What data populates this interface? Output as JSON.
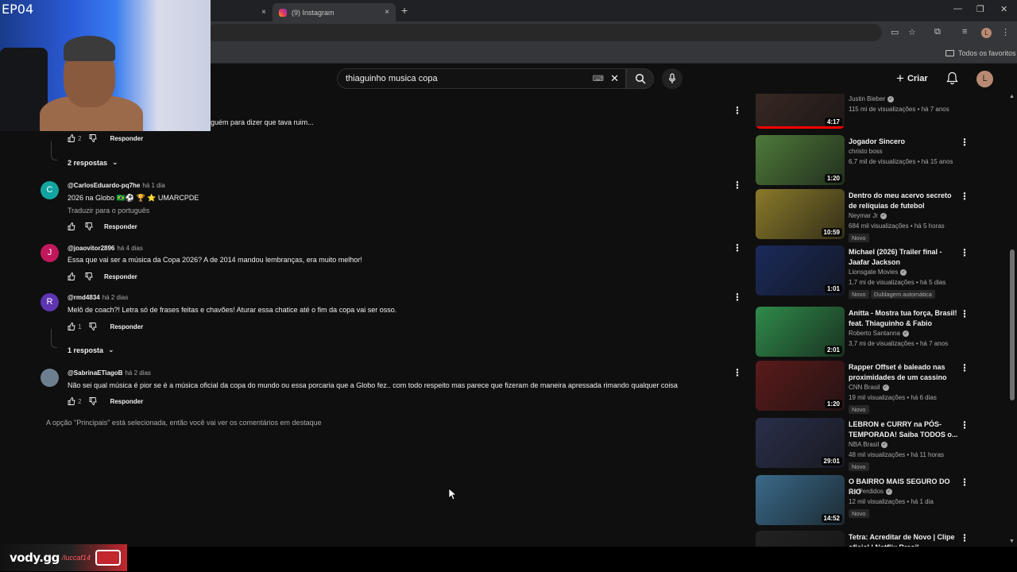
{
  "browser": {
    "tabs": [
      {
        "label": "",
        "close": "×"
      },
      {
        "label": "(9) Instagram",
        "close": "×"
      }
    ],
    "new_tab": "+",
    "window_controls": [
      "—",
      "❐",
      "✕"
    ],
    "bookmarks": {
      "all_favorites": "Todos os favoritos"
    },
    "profile_initial": "L"
  },
  "overlay": {
    "episode": "EP04",
    "vody_brand": "vody.gg",
    "vody_handle": "/luccaf14"
  },
  "header": {
    "search_query": "thiaguinho musica copa",
    "create_label": "Criar",
    "avatar_initial": "L"
  },
  "comments": {
    "items": [
      {
        "text_partial": "guém para dizer que tava ruim...",
        "likes": "2",
        "reply_label": "Responder",
        "replies_toggle": "2 respostas"
      },
      {
        "author": "@CarlosEduardo-pq7he",
        "time": "há 1 dia",
        "avatar": "C",
        "avatar_color": "#12a4a0",
        "text": "2026 na Globo 🇧🇷⚽ 🏆 ⭐ UMARCPDE",
        "translate": "Traduzir para o português",
        "reply_label": "Responder"
      },
      {
        "author": "@joaovitor2896",
        "time": "há 4 dias",
        "avatar": "J",
        "avatar_color": "#c2185b",
        "text": "Essa que vai ser a música da Copa 2026? A de 2014 mandou lembranças, era muito melhor!",
        "reply_label": "Responder"
      },
      {
        "author": "@rmd4834",
        "time": "há 2 dias",
        "avatar": "R",
        "avatar_color": "#5e35b1",
        "text": "Melô de coach?! Letra só de frases feitas e chavões! Aturar essa chatice até o fim da copa vai ser osso.",
        "likes": "1",
        "reply_label": "Responder",
        "replies_toggle": "1 resposta"
      },
      {
        "author": "@SabrinaETiagoB",
        "time": "há 2 dias",
        "avatar": "",
        "avatar_color": "#6d7f8f",
        "text": "Não sei qual música é pior se é a música oficial da copa do mundo ou essa porcaria que a Globo fez.. com todo respeito mas parece que fizeram de maneira apressada rimando qualquer coisa",
        "likes": "2",
        "reply_label": "Responder"
      }
    ],
    "footer_note": "A opção \"Principais\" está selecionada, então você vai ver os comentários em destaque"
  },
  "sidebar": {
    "videos": [
      {
        "title": "",
        "channel": "Justin Bieber",
        "verified": true,
        "stats": "115 mi de visualizações • há 7 anos",
        "duration": "4:17",
        "thumb": "#3b2a24",
        "watched": 1.0
      },
      {
        "title": "Jogador Sincero",
        "channel": "christo boss",
        "verified": false,
        "stats": "6,7 mil de visualizações • há 15 anos",
        "duration": "1:20",
        "thumb": "#4e7a3a"
      },
      {
        "title": "Dentro do meu acervo secreto de relíquias de futebol",
        "channel": "Neymar Jr",
        "verified": true,
        "stats": "684 mil visualizações • há 5 horas",
        "badge": "Novo",
        "duration": "10:59",
        "thumb": "#8a7a2a"
      },
      {
        "title": "Michael (2026) Trailer final - Jaafar Jackson",
        "channel": "Lionsgate Movies",
        "verified": true,
        "stats": "1,7 mi de visualizações • há 5 dias",
        "badge": "Novo",
        "badge2": "Dublagem automática",
        "duration": "1:01",
        "thumb": "#1a2a5a"
      },
      {
        "title": "Anitta - Mostra tua força, Brasil! feat. Thiaguinho & Fabio Brazz...",
        "channel": "Roberto Santanna",
        "verified": true,
        "stats": "3,7 mi de visualizações • há 7 anos",
        "duration": "2:01",
        "thumb": "#2f8a4a"
      },
      {
        "title": "Rapper Offset é baleado nas proximidades de um cassino n...",
        "channel": "CNN Brasil",
        "verified": true,
        "stats": "19 mil visualizações • há 6 dias",
        "badge": "Novo",
        "duration": "1:20",
        "thumb": "#5a1a1a"
      },
      {
        "title": "LEBRON e CURRY na PÓS-TEMPORADA! Saiba TODOS o...",
        "channel": "NBA Brasil",
        "verified": true,
        "stats": "48 mil visualizações • há 11 horas",
        "badge": "Novo",
        "duration": "29:01",
        "thumb": "#2a2f4a"
      },
      {
        "title": "O BAIRRO MAIS SEGURO DO RIO",
        "channel": "Os Perdidos",
        "verified": true,
        "stats": "12 mil visualizações • há 1 dia",
        "badge": "Novo",
        "duration": "14:52",
        "thumb": "#3a6a8a"
      },
      {
        "title": "Tetra: Acreditar de Novo | Clipe oficial | Netflix Brasil",
        "channel": "",
        "stats": "",
        "duration": "",
        "thumb": "#222"
      }
    ]
  }
}
